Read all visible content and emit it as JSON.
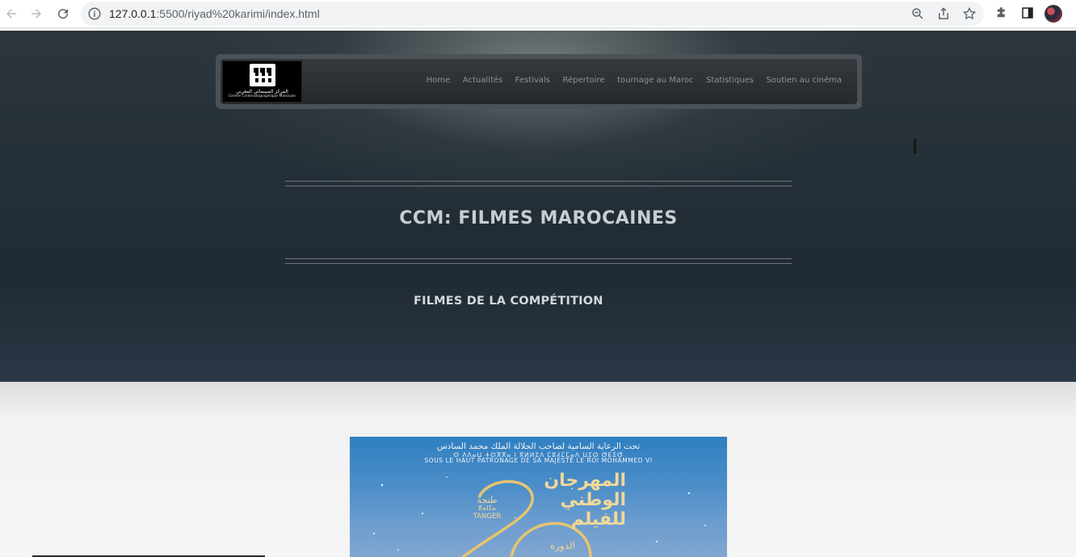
{
  "browser": {
    "url_host": "127.0.0.1",
    "url_rest": ":5500/riyad%20karimi/index.html"
  },
  "site": {
    "logo": {
      "arabic": "المركز السينمائي المغربي",
      "french": "Centre Cinématographique Marocain"
    },
    "menu": [
      "Home",
      "Actualités",
      "Festivals",
      "Répertoire",
      "tournage au Maroc",
      "Statistiques",
      "Soutien au cinéma"
    ],
    "title": "CCM: FILMES MAROCAINES",
    "subtitle": "FILMES DE LA COMPÉTITION"
  },
  "poster": {
    "patronage_ar": "تحت الرعاية السامية لصاحب الجلالة الملك محمد السادس",
    "patronage_tifinagh": "ⵙ ⴷⴷⴰⵡ ⵜⵙⴳⴳⴰ ⵏ ⴳⵍⵍⵉⴷ ⵎⵓⵃⵎⵎⴰⴷ ⵡⵉⵙ ⵚⴹⵉⵚ",
    "patronage_fr": "SOUS LE HAUT PATRONAGE DE SA MAJESTÉ LE ROI MOHAMMED VI",
    "festival_ar_1": "المهرجان",
    "festival_ar_2": "الوطني",
    "festival_ar_3": "للفيلم",
    "city_ar": "طنجة",
    "city_tifinagh": "ⵟⴰⵏⵊⴰ",
    "city_fr": "TANGER",
    "edition_ar": "الدورة"
  }
}
